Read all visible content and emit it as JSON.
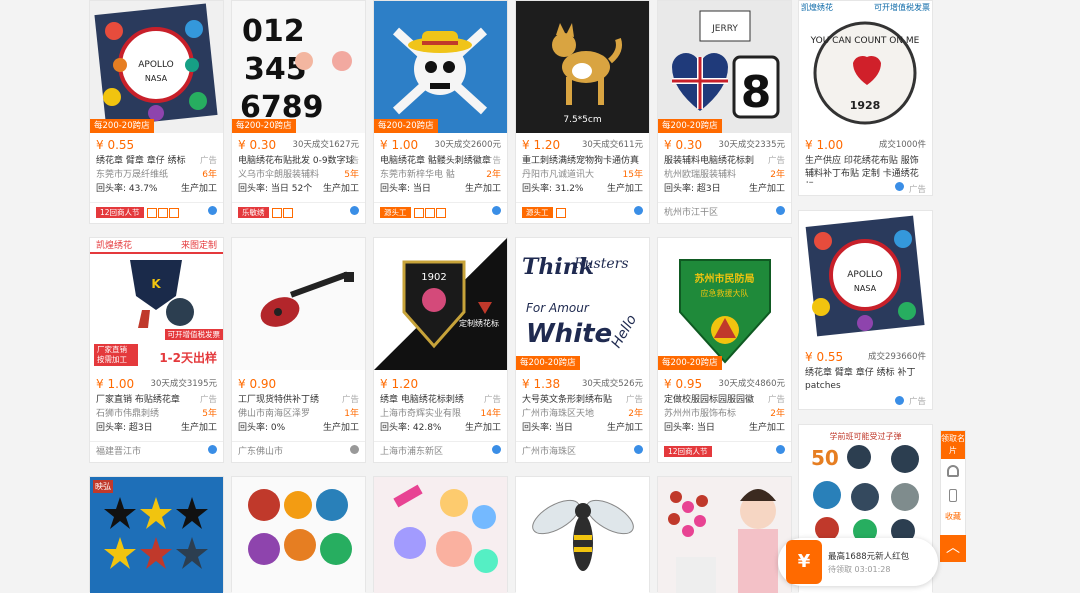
{
  "row1": [
    {
      "badge": "每200-20跨店",
      "price": "¥ 0.55",
      "sold": "",
      "title": "绣花章 臂章 章仔 绣标",
      "ad": "广告",
      "supplier": "东莞市万晟纤维纸",
      "years": "6年",
      "repurchase": "回头率: 43.7%",
      "mode": "生产加工",
      "promo": "12回商人节"
    },
    {
      "badge": "每200-20跨店",
      "price": "¥ 0.30",
      "sold": "30天成交1627元",
      "title": "电脑绣花布贴批发 0-9数字球",
      "ad": "广告",
      "supplier": "义乌市伞朗服装辅料",
      "years": "5年",
      "repurchase": "回头率: 当日 52个",
      "mode": "生产加工",
      "promo": "乐敏绣"
    },
    {
      "badge": "每200-20跨店",
      "price": "¥ 1.00",
      "sold": "30天成交2600元",
      "title": "电脑绣花章 骷髅头刺绣徽章",
      "ad": "广告",
      "supplier": "东莞市新梓华电 骷",
      "years": "2年",
      "repurchase": "回头率: 当日",
      "mode": "生产加工",
      "promo": "源头工"
    },
    {
      "badge": "",
      "price": "¥ 1.20",
      "sold": "30天成交611元",
      "title": "重工刺绣满绣宠物狗卡通仿真",
      "ad": "",
      "supplier": "丹阳市凡诚道讯大",
      "years": "15年",
      "repurchase": "回头率: 31.2%",
      "mode": "生产加工",
      "promo": "源头工",
      "caption": "7.5*5cm"
    },
    {
      "badge": "每200-20跨店",
      "price": "¥ 0.30",
      "sold": "30天成交2335元",
      "title": "服装辅料电脑绣花标刺",
      "ad": "广告",
      "supplier": "杭州欧瑞服装辅料",
      "years": "2年",
      "repurchase": "回头率: 超3日",
      "mode": "生产加工",
      "promo": "杭州市江干区"
    },
    {
      "badge": "",
      "price": "¥ 1.00",
      "sold": "成交1000件",
      "title": "生产供应 印花绣花布贴 服饰辅料补丁布贴 定制 卡通绣花标",
      "ad": "广告",
      "supplier": "",
      "years": "",
      "repurchase": "",
      "mode": "",
      "promo": "",
      "header_left": "凯煌绣花",
      "header_right": "可开增值税发票"
    }
  ],
  "row2": [
    {
      "badge": "",
      "price": "¥ 1.00",
      "sold": "30天成交3195元",
      "title": "厂家直销 布贴绣花章",
      "ad": "广告",
      "supplier": "石狮市伟鼎刺绣",
      "years": "5年",
      "repurchase": "回头率: 超3日",
      "mode": "生产加工",
      "location": "福建晋江市",
      "header_left": "凯煌绣花",
      "header_right": "来图定制",
      "footer1": "可开增值税发票",
      "footer2": "厂家直销 按需加工",
      "footer3": "1-2天出样"
    },
    {
      "badge": "",
      "price": "¥ 0.90",
      "sold": "",
      "title": "工厂现货特供补丁绣",
      "ad": "广告",
      "supplier": "佛山市南海区泽罗",
      "years": "1年",
      "repurchase": "回头率: 0%",
      "mode": "生产加工",
      "location": "广东佛山市"
    },
    {
      "badge": "",
      "price": "¥ 1.20",
      "sold": "",
      "title": "绣章 电脑绣花标刺绣",
      "ad": "广告",
      "supplier": "上海市奇辉实业有限",
      "years": "14年",
      "repurchase": "回头率: 42.8%",
      "mode": "生产加工",
      "location": "上海市浦东新区",
      "caption": "定制绣花标"
    },
    {
      "badge": "每200-20跨店",
      "price": "¥ 1.38",
      "sold": "30天成交526元",
      "title": "大号英文条形刺绣布贴",
      "ad": "广告",
      "supplier": "广州市海珠区天地",
      "years": "2年",
      "repurchase": "回头率: 当日",
      "mode": "生产加工",
      "location": "广州市海珠区"
    },
    {
      "badge": "每200-20跨店",
      "price": "¥ 0.95",
      "sold": "30天成交4860元",
      "title": "定做校服园标园服园徽",
      "ad": "广告",
      "supplier": "苏州州市服饰布标",
      "years": "2年",
      "repurchase": "回头率: 当日",
      "mode": "生产加工",
      "location": "",
      "promo": "12回商人节",
      "caption": "苏州市民防局",
      "caption2": "应急救援大队"
    },
    {
      "badge": "",
      "price": "¥ 0.55",
      "sold": "成交293660件",
      "title": "绣花章 臂章 章仔 绣标 补丁 patches",
      "ad": "广告",
      "supplier": "",
      "years": "",
      "repurchase": "",
      "mode": "",
      "location": ""
    }
  ],
  "row3": [
    {
      "brand": "映弘"
    },
    {},
    {},
    {},
    {},
    {
      "caption": "学前班可能受过子弹"
    }
  ],
  "sidebar": {
    "label1": "领取名片",
    "label2": "收藏"
  },
  "popup": {
    "title": "最高1688元新人红包",
    "sub": "待领取",
    "timer": "03:01:28"
  }
}
